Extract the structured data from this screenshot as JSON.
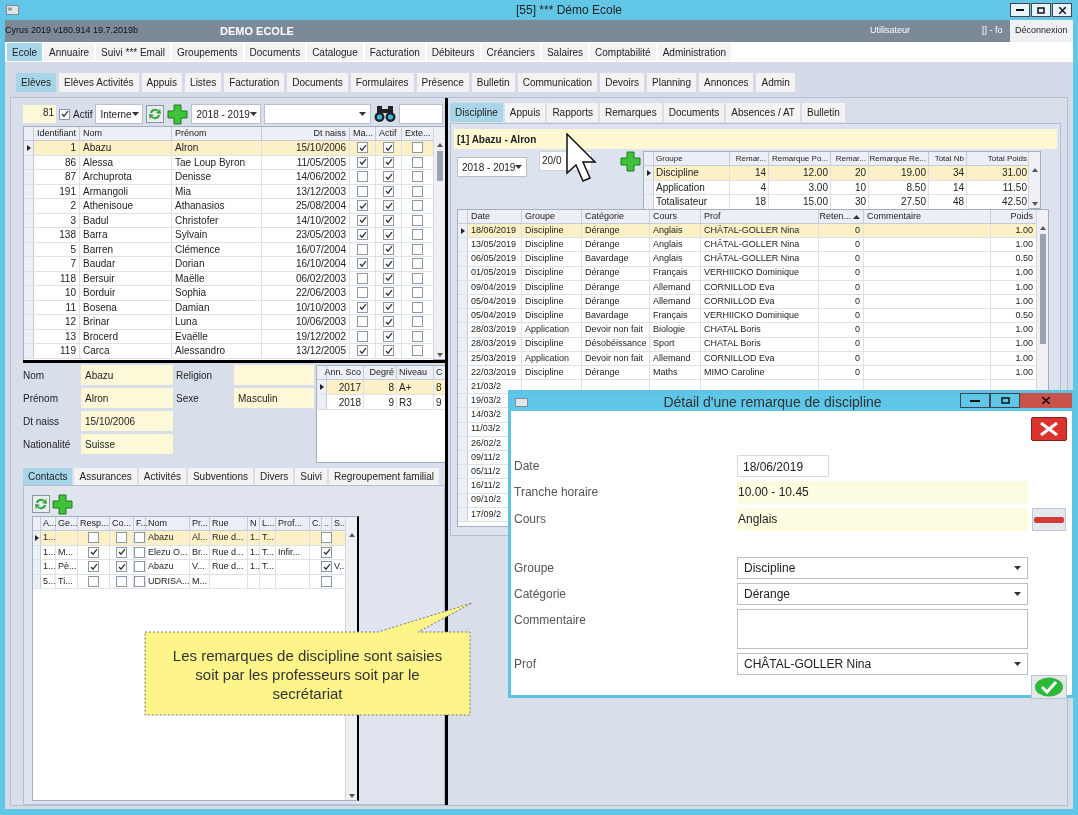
{
  "window": {
    "title": "[55] *** Démo Ecole"
  },
  "header": {
    "version": "Cyrus 2019 v180.914 19.7.2019b",
    "school": "DEMO ECOLE",
    "user_label": "Utilisateur",
    "user": "[] - fo",
    "logout": "Déconnexion"
  },
  "main_tabs": [
    {
      "label": "Ecole",
      "selected": true
    },
    {
      "label": "Annuaire",
      "selected": false
    },
    {
      "label": "Suivi *** Email",
      "selected": false
    },
    {
      "label": "Groupements",
      "selected": false
    },
    {
      "label": "Documents",
      "selected": false
    },
    {
      "label": "Catalogue",
      "selected": false
    },
    {
      "label": "Facturation",
      "selected": false
    },
    {
      "label": "Débiteurs",
      "selected": false
    },
    {
      "label": "Créanciers",
      "selected": false
    },
    {
      "label": "Salaires",
      "selected": false
    },
    {
      "label": "Comptabilité",
      "selected": false
    },
    {
      "label": "Administration",
      "selected": false
    }
  ],
  "sub_tabs": [
    {
      "label": "Elèves",
      "selected": true
    },
    {
      "label": "Elèves Activités",
      "selected": false
    },
    {
      "label": "Appuis",
      "selected": false
    },
    {
      "label": "Listes",
      "selected": false
    },
    {
      "label": "Facturation",
      "selected": false
    },
    {
      "label": "Documents",
      "selected": false
    },
    {
      "label": "Formulaires",
      "selected": false
    },
    {
      "label": "Présence",
      "selected": false
    },
    {
      "label": "Bulletin",
      "selected": false
    },
    {
      "label": "Communication",
      "selected": false
    },
    {
      "label": "Devoirs",
      "selected": false
    },
    {
      "label": "Planning",
      "selected": false
    },
    {
      "label": "Annonces",
      "selected": false
    },
    {
      "label": "Admin",
      "selected": false
    }
  ],
  "toolbar": {
    "count": "81",
    "actif_label": "Actif",
    "actif_checked": true,
    "type": "Interne",
    "year": "2018 - 2019"
  },
  "students": {
    "columns": [
      "Identifiant",
      "Nom",
      "Prénom",
      "Dt naiss",
      "Ma...",
      "Actif",
      "Exte..."
    ],
    "rows": [
      {
        "id": "1",
        "nom": "Abazu",
        "prenom": "Alron",
        "dt": "15/10/2006",
        "ma": true,
        "actif": true,
        "exte": false,
        "selected": true
      },
      {
        "id": "86",
        "nom": "Alessa",
        "prenom": "Tae Loup Byron",
        "dt": "11/05/2005",
        "ma": true,
        "actif": true,
        "exte": false,
        "selected": false
      },
      {
        "id": "87",
        "nom": "Archuprota",
        "prenom": "Denisse",
        "dt": "14/06/2002",
        "ma": false,
        "actif": true,
        "exte": false,
        "selected": false
      },
      {
        "id": "191",
        "nom": "Armangoli",
        "prenom": "Mia",
        "dt": "13/12/2003",
        "ma": false,
        "actif": true,
        "exte": false,
        "selected": false
      },
      {
        "id": "2",
        "nom": "Athenisoue",
        "prenom": "Athanasios",
        "dt": "25/08/2004",
        "ma": true,
        "actif": true,
        "exte": false,
        "selected": false
      },
      {
        "id": "3",
        "nom": "Badul",
        "prenom": "Christofer",
        "dt": "14/10/2002",
        "ma": true,
        "actif": true,
        "exte": false,
        "selected": false
      },
      {
        "id": "138",
        "nom": "Barra",
        "prenom": "Sylvain",
        "dt": "23/05/2003",
        "ma": true,
        "actif": true,
        "exte": false,
        "selected": false
      },
      {
        "id": "5",
        "nom": "Barren",
        "prenom": "Clémence",
        "dt": "16/07/2004",
        "ma": false,
        "actif": true,
        "exte": false,
        "selected": false
      },
      {
        "id": "7",
        "nom": "Baudar",
        "prenom": "Dorian",
        "dt": "16/10/2004",
        "ma": true,
        "actif": true,
        "exte": false,
        "selected": false
      },
      {
        "id": "118",
        "nom": "Bersuir",
        "prenom": "Maëlle",
        "dt": "06/02/2003",
        "ma": false,
        "actif": true,
        "exte": false,
        "selected": false
      },
      {
        "id": "10",
        "nom": "Borduir",
        "prenom": "Sophia",
        "dt": "22/06/2003",
        "ma": false,
        "actif": true,
        "exte": false,
        "selected": false
      },
      {
        "id": "11",
        "nom": "Bosena",
        "prenom": "Damian",
        "dt": "10/10/2003",
        "ma": true,
        "actif": true,
        "exte": false,
        "selected": false
      },
      {
        "id": "12",
        "nom": "Brinar",
        "prenom": "Luna",
        "dt": "10/06/2003",
        "ma": false,
        "actif": true,
        "exte": false,
        "selected": false
      },
      {
        "id": "13",
        "nom": "Brocerd",
        "prenom": "Evaëlle",
        "dt": "19/12/2002",
        "ma": false,
        "actif": true,
        "exte": false,
        "selected": false
      },
      {
        "id": "119",
        "nom": "Carca",
        "prenom": "Alessandro",
        "dt": "13/12/2005",
        "ma": true,
        "actif": true,
        "exte": false,
        "selected": false
      }
    ]
  },
  "details": {
    "left": [
      {
        "label": "Nom",
        "value": "Abazu"
      },
      {
        "label": "Prénom",
        "value": "Alron"
      },
      {
        "label": "Dt naiss",
        "value": "15/10/2006"
      },
      {
        "label": "Nationalité",
        "value": "Suisse"
      }
    ],
    "right": [
      {
        "label": "Religion"
      },
      {
        "label": "Sexe",
        "value": "Masculin"
      }
    ]
  },
  "history": {
    "columns": [
      "Ann. Sco",
      "Degré",
      "Niveau",
      "C"
    ],
    "rows": [
      {
        "cells": [
          "2017",
          "8",
          "A+",
          "8"
        ],
        "selected": true
      },
      {
        "cells": [
          "2018",
          "9",
          "R3",
          "9"
        ],
        "selected": false
      }
    ]
  },
  "contact_tabs": [
    {
      "label": "Contacts",
      "selected": true
    },
    {
      "label": "Assurances",
      "selected": false
    },
    {
      "label": "Activités",
      "selected": false
    },
    {
      "label": "Subventions",
      "selected": false
    },
    {
      "label": "Divers",
      "selected": false
    },
    {
      "label": "Suivi",
      "selected": false
    },
    {
      "label": "Regroupement familial",
      "selected": false
    }
  ],
  "contacts": {
    "columns": [
      "A...",
      "Ge...",
      "Resp...",
      "Co...",
      "F...",
      "Nom",
      "Pr...",
      "Rue",
      "N",
      "L...",
      "Prof...",
      "C.",
      "..",
      "S..."
    ],
    "rows": [
      {
        "a": "1...",
        "resp": false,
        "co": false,
        "f": false,
        "nom": "Abazu",
        "pr": "Al...",
        "rue": "Rue d...",
        "n": "1..",
        "l": "T...",
        "x": false,
        "selected": true
      },
      {
        "a": "1...",
        "ge": "M...",
        "resp": true,
        "co": true,
        "f": false,
        "nom": "Elezu O...",
        "pr": "Br...",
        "rue": "Rue d...",
        "n": "1..",
        "l": "T...",
        "prof": "Infir...",
        "x": true,
        "selected": false
      },
      {
        "a": "1...",
        "ge": "Pè...",
        "resp": true,
        "co": true,
        "f": false,
        "nom": "Abazu",
        "pr": "V...",
        "rue": "Rue d...",
        "n": "1..",
        "l": "T...",
        "x": true,
        "s": "V...",
        "selected": false
      },
      {
        "a": "5...",
        "ge": "Ti...",
        "resp": false,
        "co": false,
        "f": false,
        "nom": "UDRISA...",
        "pr": "M...",
        "x": false,
        "selected": false
      }
    ]
  },
  "right_tabs": [
    {
      "label": "Discipline",
      "selected": true
    },
    {
      "label": "Appuis",
      "selected": false
    },
    {
      "label": "Rapports",
      "selected": false
    },
    {
      "label": "Remarques",
      "selected": false
    },
    {
      "label": "Documents",
      "selected": false
    },
    {
      "label": "Absences / AT",
      "selected": false
    },
    {
      "label": "Bulletin",
      "selected": false
    }
  ],
  "discipline": {
    "student": "[1] Abazu - Alron",
    "year": "2018 - 2019",
    "date": "20/0",
    "summary": {
      "columns": [
        "Groupe",
        "Remar...",
        "Remarque Po...",
        "Remar...",
        "Remarque Re...",
        "Total Nb",
        "Total Poids"
      ],
      "rows": [
        {
          "cells": [
            "Discipline",
            "14",
            "12.00",
            "20",
            "19.00",
            "34",
            "31.00"
          ],
          "selected": true
        },
        {
          "cells": [
            "Application",
            "4",
            "3.00",
            "10",
            "8.50",
            "14",
            "11.50"
          ],
          "selected": false
        },
        {
          "cells": [
            "Totalisateur",
            "18",
            "15.00",
            "30",
            "27.50",
            "48",
            "42.50"
          ],
          "selected": false
        }
      ]
    },
    "remarks": {
      "columns": [
        {
          "label": "Date",
          "sorted": false
        },
        {
          "label": "Groupe",
          "sorted": false
        },
        {
          "label": "Catégorie",
          "sorted": false
        },
        {
          "label": "Cours",
          "sorted": false
        },
        {
          "label": "Prof",
          "sorted": false
        },
        {
          "label": "Reten...",
          "sorted": true
        },
        {
          "label": "Commentaire",
          "sorted": false
        },
        {
          "label": "Poids",
          "sorted": false
        }
      ],
      "rows": [
        {
          "date": "18/06/2019",
          "groupe": "Discipline",
          "categorie": "Dérange",
          "cours": "Anglais",
          "prof": "CHÂTAL-GOLLER Nina",
          "reten": "0",
          "poids": "1.00",
          "selected": true
        },
        {
          "date": "13/05/2019",
          "groupe": "Discipline",
          "categorie": "Dérange",
          "cours": "Anglais",
          "prof": "CHÂTAL-GOLLER Nina",
          "reten": "0",
          "poids": "1.00",
          "selected": false
        },
        {
          "date": "06/05/2019",
          "groupe": "Discipline",
          "categorie": "Bavardage",
          "cours": "Anglais",
          "prof": "CHÂTAL-GOLLER Nina",
          "reten": "0",
          "poids": "0.50",
          "selected": false
        },
        {
          "date": "01/05/2019",
          "groupe": "Discipline",
          "categorie": "Dérange",
          "cours": "Français",
          "prof": "VERHIICKO Dominique",
          "reten": "0",
          "poids": "1.00",
          "selected": false
        },
        {
          "date": "09/04/2019",
          "groupe": "Discipline",
          "categorie": "Dérange",
          "cours": "Allemand",
          "prof": "CORNILLOD Eva",
          "reten": "0",
          "poids": "1.00",
          "selected": false
        },
        {
          "date": "05/04/2019",
          "groupe": "Discipline",
          "categorie": "Dérange",
          "cours": "Allemand",
          "prof": "CORNILLOD Eva",
          "reten": "0",
          "poids": "1.00",
          "selected": false
        },
        {
          "date": "05/04/2019",
          "groupe": "Discipline",
          "categorie": "Bavardage",
          "cours": "Français",
          "prof": "VERHIICKO Dominique",
          "reten": "0",
          "poids": "0.50",
          "selected": false
        },
        {
          "date": "28/03/2019",
          "groupe": "Application",
          "categorie": "Devoir non fait",
          "cours": "Biologie",
          "prof": "CHATAL Boris",
          "reten": "0",
          "poids": "1.00",
          "selected": false
        },
        {
          "date": "28/03/2019",
          "groupe": "Discipline",
          "categorie": "Désobéissance",
          "cours": "Sport",
          "prof": "CHATAL Boris",
          "reten": "0",
          "poids": "1.00",
          "selected": false
        },
        {
          "date": "25/03/2019",
          "groupe": "Application",
          "categorie": "Devoir non fait",
          "cours": "Allemand",
          "prof": "CORNILLOD Eva",
          "reten": "0",
          "poids": "1.00",
          "selected": false
        },
        {
          "date": "22/03/2019",
          "groupe": "Discipline",
          "categorie": "Dérange",
          "cours": "Maths",
          "prof": "MIMO Caroline",
          "reten": "0",
          "poids": "1.00",
          "selected": false
        },
        {
          "date": "21/03/2",
          "selected": false
        },
        {
          "date": "19/03/2",
          "selected": false
        },
        {
          "date": "14/03/2",
          "selected": false
        },
        {
          "date": "11/03/2",
          "selected": false
        },
        {
          "date": "26/02/2",
          "selected": false
        },
        {
          "date": "09/11/2",
          "selected": false
        },
        {
          "date": "05/11/2",
          "selected": false
        },
        {
          "date": "16/11/2",
          "selected": false
        },
        {
          "date": "09/10/2",
          "selected": false
        },
        {
          "date": "17/09/2",
          "selected": false
        }
      ]
    }
  },
  "dialog": {
    "title": "Détail d'une remarque de discipline",
    "fields": [
      {
        "label": "Date",
        "value": "18/06/2019",
        "kind": "date",
        "clearable": false
      },
      {
        "label": "Tranche horaire",
        "value": "10.00 - 10.45",
        "kind": "readonly",
        "clearable": false
      },
      {
        "label": "Cours",
        "value": "Anglais",
        "kind": "readonly",
        "clearable": true
      },
      {
        "label": "Groupe",
        "value": "Discipline",
        "kind": "select",
        "clearable": false
      },
      {
        "label": "Catégorie",
        "value": "Dérange",
        "kind": "select",
        "clearable": false
      },
      {
        "label": "Commentaire",
        "kind": "textarea",
        "clearable": false
      },
      {
        "label": "Prof",
        "value": "CHÂTAL-GOLLER Nina",
        "kind": "select",
        "clearable": false
      }
    ]
  },
  "callout": {
    "text": "Les remarques de discipline sont saisies soit par les professeurs soit par le secrétariat"
  }
}
